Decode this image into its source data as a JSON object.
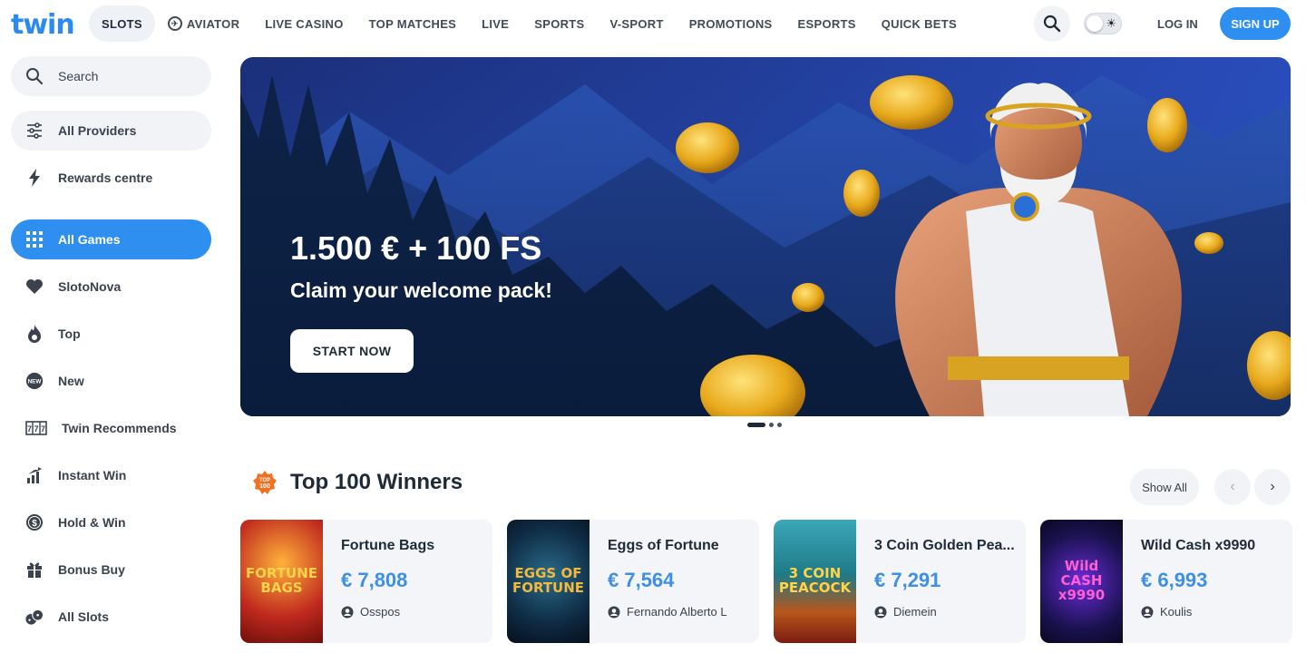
{
  "brand": {
    "logo_text": "twin",
    "accent": "#2f8ff0"
  },
  "nav": {
    "items": [
      {
        "label": "SLOTS",
        "active": true
      },
      {
        "label": "AVIATOR",
        "icon": "aviator-icon"
      },
      {
        "label": "LIVE CASINO"
      },
      {
        "label": "TOP MATCHES"
      },
      {
        "label": "LIVE"
      },
      {
        "label": "SPORTS"
      },
      {
        "label": "V-SPORT"
      },
      {
        "label": "PROMOTIONS"
      },
      {
        "label": "ESPORTS"
      },
      {
        "label": "QUICK BETS"
      }
    ],
    "login": "LOG IN",
    "signup": "SIGN UP"
  },
  "sidebar": {
    "search": "Search",
    "providers": "All Providers",
    "rewards": "Rewards centre",
    "items": [
      {
        "label": "All Games",
        "icon": "grid-icon"
      },
      {
        "label": "SlotoNova",
        "icon": "heart-icon"
      },
      {
        "label": "Top",
        "icon": "flame-icon"
      },
      {
        "label": "New",
        "icon": "new-badge-icon"
      },
      {
        "label": "Twin Recommends",
        "icon": "slot-machine-icon"
      },
      {
        "label": "Instant Win",
        "icon": "signal-bars-icon"
      },
      {
        "label": "Hold & Win",
        "icon": "dollar-coin-icon"
      },
      {
        "label": "Bonus Buy",
        "icon": "gift-icon"
      },
      {
        "label": "All Slots",
        "icon": "dice-icon"
      }
    ]
  },
  "banner": {
    "title": "1.500 € + 100 FS",
    "subtitle": "Claim your welcome pack!",
    "cta": "START NOW"
  },
  "winners": {
    "title": "Top 100 Winners",
    "badge_text": "TOP 100",
    "show_all": "Show All",
    "cards": [
      {
        "game": "Fortune Bags",
        "amount": "€ 7,808",
        "player": "Osspos",
        "thumb_text": "FORTUNE BAGS",
        "thumb_color": "#b3221b"
      },
      {
        "game": "Eggs of Fortune",
        "amount": "€ 7,564",
        "player": "Fernando Alberto L",
        "thumb_text": "EGGS OF FORTUNE",
        "thumb_color": "#0f2c45"
      },
      {
        "game": "3 Coin Golden Pea...",
        "amount": "€ 7,291",
        "player": "Diemein",
        "thumb_text": "3 COIN PEACOCK",
        "thumb_color": "#1f7a86"
      },
      {
        "game": "Wild Cash x9990",
        "amount": "€ 6,993",
        "player": "Koulis",
        "thumb_text": "Wild CASH x9990",
        "thumb_color": "#1a1250"
      }
    ]
  }
}
